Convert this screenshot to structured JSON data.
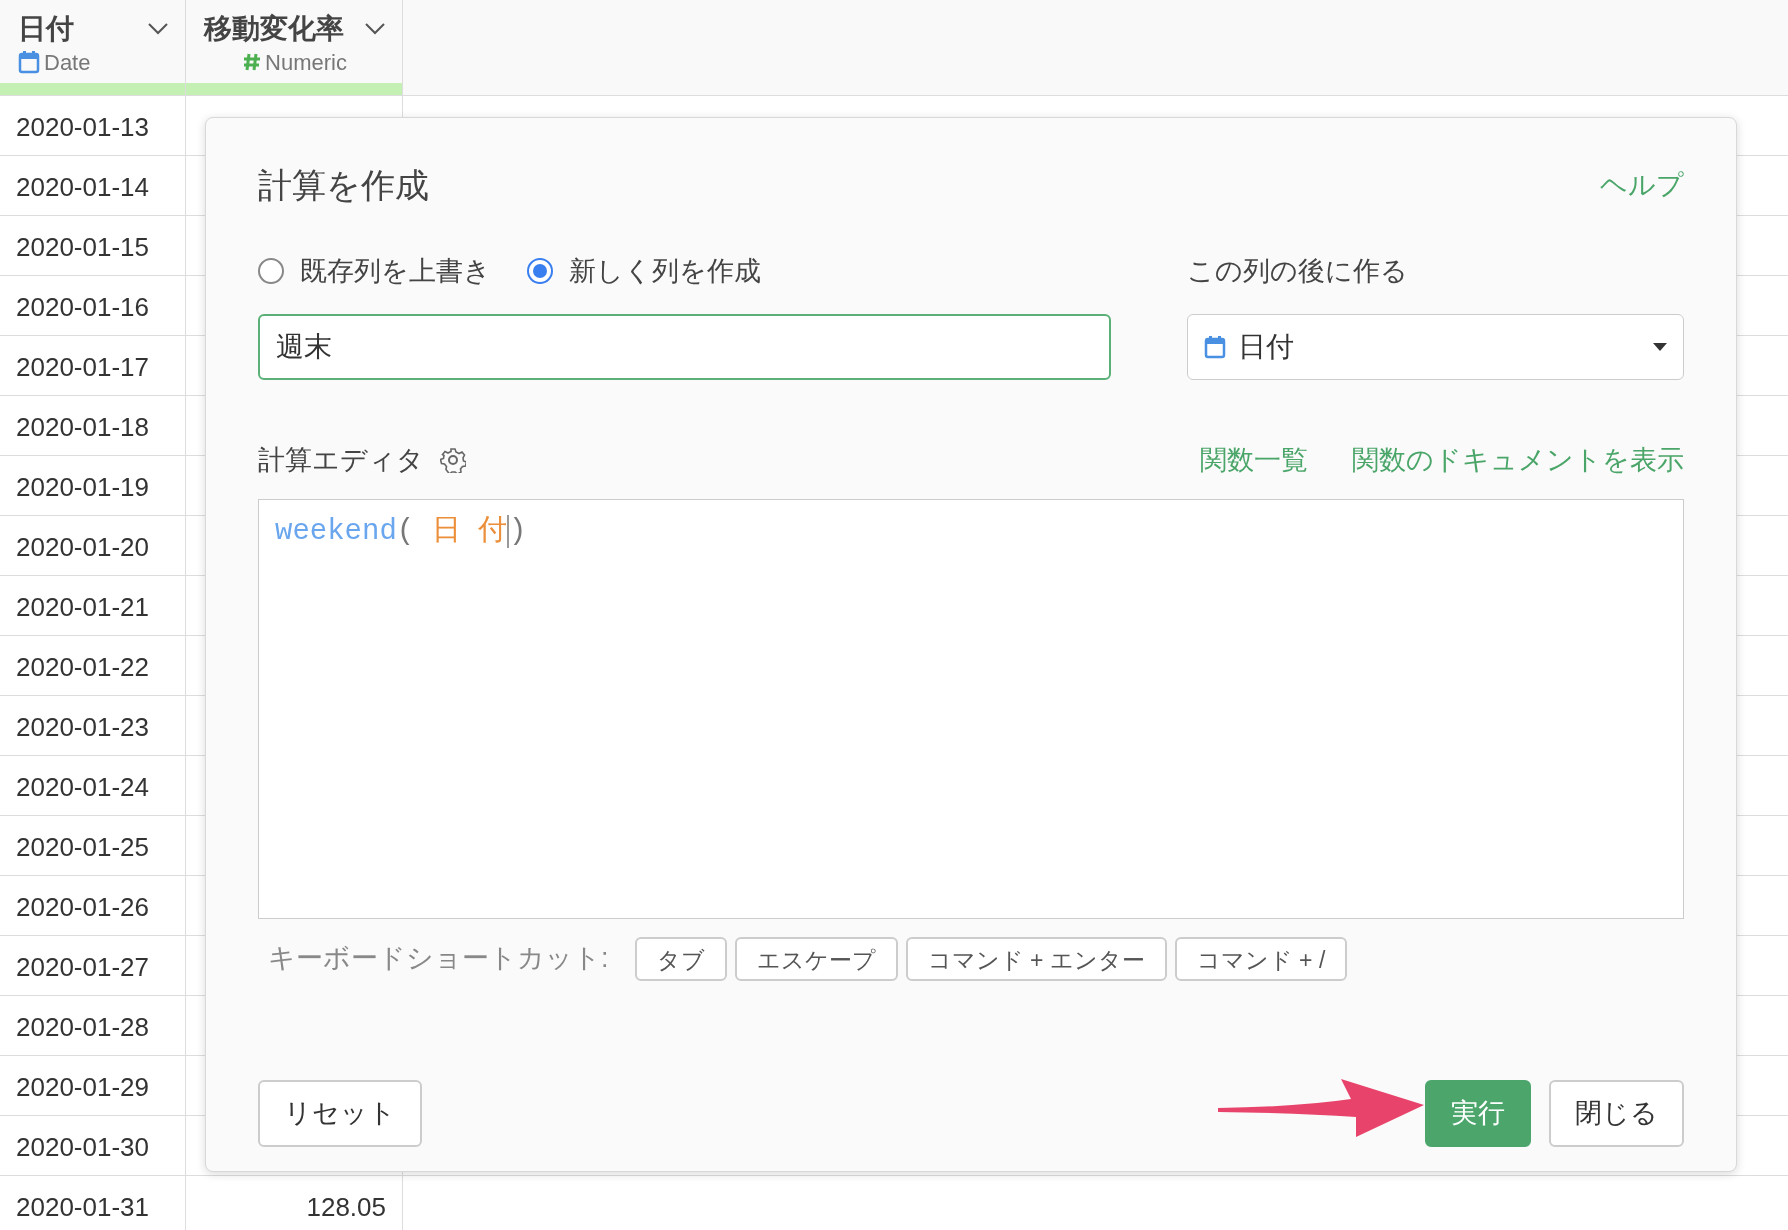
{
  "table": {
    "columns": [
      {
        "name": "日付",
        "type": "Date",
        "kind": "date"
      },
      {
        "name": "移動変化率",
        "type": "Numeric",
        "kind": "numeric"
      }
    ],
    "rows": [
      {
        "cells": [
          "2020-01-13"
        ]
      },
      {
        "cells": [
          "2020-01-14"
        ]
      },
      {
        "cells": [
          "2020-01-15"
        ]
      },
      {
        "cells": [
          "2020-01-16"
        ]
      },
      {
        "cells": [
          "2020-01-17"
        ]
      },
      {
        "cells": [
          "2020-01-18"
        ]
      },
      {
        "cells": [
          "2020-01-19"
        ]
      },
      {
        "cells": [
          "2020-01-20"
        ]
      },
      {
        "cells": [
          "2020-01-21"
        ]
      },
      {
        "cells": [
          "2020-01-22"
        ]
      },
      {
        "cells": [
          "2020-01-23"
        ]
      },
      {
        "cells": [
          "2020-01-24"
        ]
      },
      {
        "cells": [
          "2020-01-25"
        ]
      },
      {
        "cells": [
          "2020-01-26"
        ]
      },
      {
        "cells": [
          "2020-01-27"
        ]
      },
      {
        "cells": [
          "2020-01-28"
        ]
      },
      {
        "cells": [
          "2020-01-29"
        ]
      },
      {
        "cells": [
          "2020-01-30"
        ]
      },
      {
        "cells": [
          "2020-01-31",
          "128.05"
        ]
      }
    ]
  },
  "dialog": {
    "title": "計算を作成",
    "help_link": "ヘルプ",
    "mode_options": [
      {
        "label": "既存列を上書き",
        "selected": false
      },
      {
        "label": "新しく列を作成",
        "selected": true
      }
    ],
    "name_input": {
      "value": "週末"
    },
    "after_column": {
      "label": "この列の後に作る",
      "value": "日付",
      "kind": "date"
    },
    "editor": {
      "label": "計算エディタ",
      "links": [
        "関数一覧",
        "関数のドキュメントを表示"
      ],
      "code": [
        {
          "text": "weekend",
          "kind": "function",
          "cursor": false
        },
        {
          "text": "(",
          "kind": "punct",
          "cursor": false
        },
        {
          "text": " 日 付",
          "kind": "column",
          "cursor": true
        },
        {
          "text": ")",
          "kind": "punct",
          "cursor": false
        }
      ]
    },
    "shortcuts": {
      "label": "キーボードショートカット:",
      "keys": [
        "タブ",
        "エスケープ",
        "コマンド + エンター",
        "コマンド + /"
      ]
    },
    "buttons": [
      {
        "label": "リセット",
        "kind": "secondary"
      },
      {
        "label": "実行",
        "kind": "primary"
      },
      {
        "label": "閉じる",
        "kind": "secondary"
      }
    ]
  }
}
